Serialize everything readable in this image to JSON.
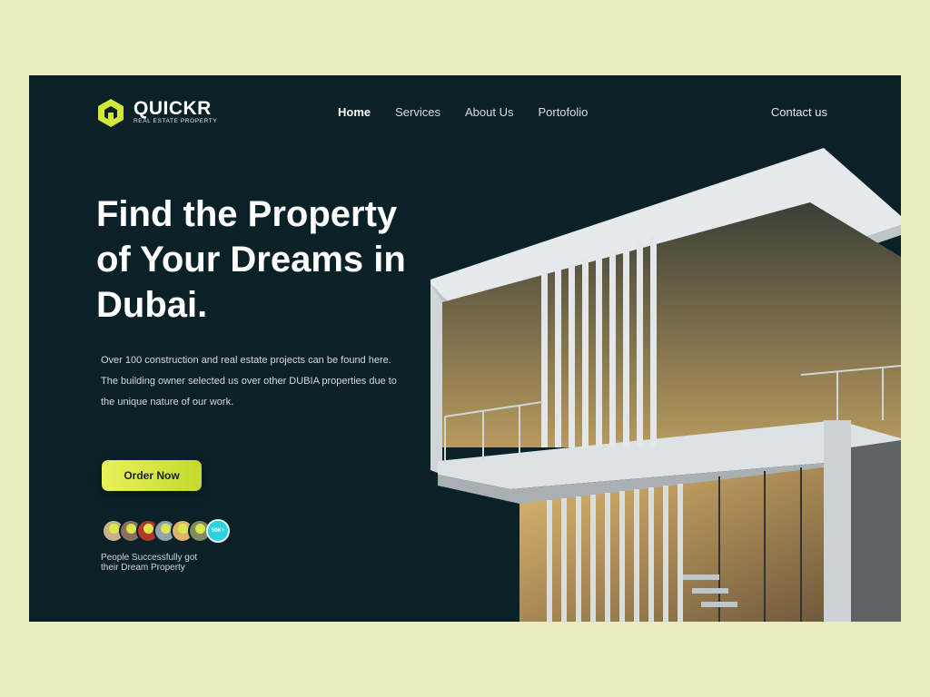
{
  "brand": {
    "name": "QUICKR",
    "tagline": "REAL ESTATE PROPERTY",
    "accent_color": "#d4e63a",
    "logo_icon": "hexagon-house-icon"
  },
  "nav": {
    "items": [
      {
        "label": "Home",
        "active": true
      },
      {
        "label": "Services",
        "active": false
      },
      {
        "label": "About Us",
        "active": false
      },
      {
        "label": "Portofolio",
        "active": false
      }
    ],
    "contact": "Contact us"
  },
  "hero": {
    "title_lines": [
      "Find the Property",
      "of Your Dreams in",
      "Dubai."
    ],
    "description_lines": [
      "Over 100 construction and real estate projects can be found here.",
      "The building owner selected us over other DUBIA properties due to",
      "the unique nature of our work."
    ],
    "cta": "Order Now",
    "avatars": {
      "colors": [
        "#c9b18a",
        "#8d6e63",
        "#b03a2e",
        "#90a4ae",
        "#e0b46c",
        "#7e8b63"
      ],
      "more_label": "50K+",
      "more_color": "#26d3df"
    },
    "social_proof_lines": [
      "People Successfully got",
      "their Dream Property"
    ],
    "image": "modern-house-photo"
  },
  "colors": {
    "background": "#e9ecbf",
    "panel": "#0b2128",
    "text": "#ffffff"
  }
}
